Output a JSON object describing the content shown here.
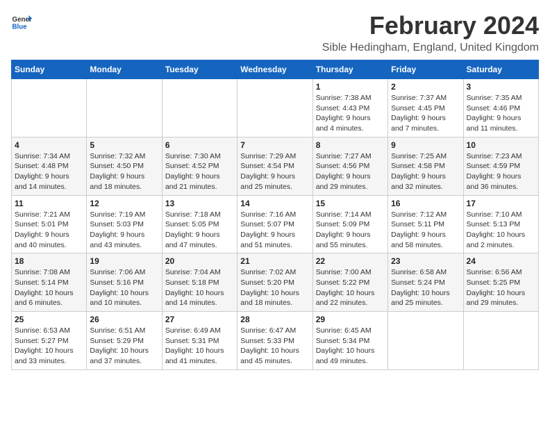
{
  "logo": {
    "line1": "General",
    "line2": "Blue"
  },
  "title": "February 2024",
  "subtitle": "Sible Hedingham, England, United Kingdom",
  "days_of_week": [
    "Sunday",
    "Monday",
    "Tuesday",
    "Wednesday",
    "Thursday",
    "Friday",
    "Saturday"
  ],
  "weeks": [
    [
      {
        "day": "",
        "info": ""
      },
      {
        "day": "",
        "info": ""
      },
      {
        "day": "",
        "info": ""
      },
      {
        "day": "",
        "info": ""
      },
      {
        "day": "1",
        "info": "Sunrise: 7:38 AM\nSunset: 4:43 PM\nDaylight: 9 hours\nand 4 minutes."
      },
      {
        "day": "2",
        "info": "Sunrise: 7:37 AM\nSunset: 4:45 PM\nDaylight: 9 hours\nand 7 minutes."
      },
      {
        "day": "3",
        "info": "Sunrise: 7:35 AM\nSunset: 4:46 PM\nDaylight: 9 hours\nand 11 minutes."
      }
    ],
    [
      {
        "day": "4",
        "info": "Sunrise: 7:34 AM\nSunset: 4:48 PM\nDaylight: 9 hours\nand 14 minutes."
      },
      {
        "day": "5",
        "info": "Sunrise: 7:32 AM\nSunset: 4:50 PM\nDaylight: 9 hours\nand 18 minutes."
      },
      {
        "day": "6",
        "info": "Sunrise: 7:30 AM\nSunset: 4:52 PM\nDaylight: 9 hours\nand 21 minutes."
      },
      {
        "day": "7",
        "info": "Sunrise: 7:29 AM\nSunset: 4:54 PM\nDaylight: 9 hours\nand 25 minutes."
      },
      {
        "day": "8",
        "info": "Sunrise: 7:27 AM\nSunset: 4:56 PM\nDaylight: 9 hours\nand 29 minutes."
      },
      {
        "day": "9",
        "info": "Sunrise: 7:25 AM\nSunset: 4:58 PM\nDaylight: 9 hours\nand 32 minutes."
      },
      {
        "day": "10",
        "info": "Sunrise: 7:23 AM\nSunset: 4:59 PM\nDaylight: 9 hours\nand 36 minutes."
      }
    ],
    [
      {
        "day": "11",
        "info": "Sunrise: 7:21 AM\nSunset: 5:01 PM\nDaylight: 9 hours\nand 40 minutes."
      },
      {
        "day": "12",
        "info": "Sunrise: 7:19 AM\nSunset: 5:03 PM\nDaylight: 9 hours\nand 43 minutes."
      },
      {
        "day": "13",
        "info": "Sunrise: 7:18 AM\nSunset: 5:05 PM\nDaylight: 9 hours\nand 47 minutes."
      },
      {
        "day": "14",
        "info": "Sunrise: 7:16 AM\nSunset: 5:07 PM\nDaylight: 9 hours\nand 51 minutes."
      },
      {
        "day": "15",
        "info": "Sunrise: 7:14 AM\nSunset: 5:09 PM\nDaylight: 9 hours\nand 55 minutes."
      },
      {
        "day": "16",
        "info": "Sunrise: 7:12 AM\nSunset: 5:11 PM\nDaylight: 9 hours\nand 58 minutes."
      },
      {
        "day": "17",
        "info": "Sunrise: 7:10 AM\nSunset: 5:13 PM\nDaylight: 10 hours\nand 2 minutes."
      }
    ],
    [
      {
        "day": "18",
        "info": "Sunrise: 7:08 AM\nSunset: 5:14 PM\nDaylight: 10 hours\nand 6 minutes."
      },
      {
        "day": "19",
        "info": "Sunrise: 7:06 AM\nSunset: 5:16 PM\nDaylight: 10 hours\nand 10 minutes."
      },
      {
        "day": "20",
        "info": "Sunrise: 7:04 AM\nSunset: 5:18 PM\nDaylight: 10 hours\nand 14 minutes."
      },
      {
        "day": "21",
        "info": "Sunrise: 7:02 AM\nSunset: 5:20 PM\nDaylight: 10 hours\nand 18 minutes."
      },
      {
        "day": "22",
        "info": "Sunrise: 7:00 AM\nSunset: 5:22 PM\nDaylight: 10 hours\nand 22 minutes."
      },
      {
        "day": "23",
        "info": "Sunrise: 6:58 AM\nSunset: 5:24 PM\nDaylight: 10 hours\nand 25 minutes."
      },
      {
        "day": "24",
        "info": "Sunrise: 6:56 AM\nSunset: 5:25 PM\nDaylight: 10 hours\nand 29 minutes."
      }
    ],
    [
      {
        "day": "25",
        "info": "Sunrise: 6:53 AM\nSunset: 5:27 PM\nDaylight: 10 hours\nand 33 minutes."
      },
      {
        "day": "26",
        "info": "Sunrise: 6:51 AM\nSunset: 5:29 PM\nDaylight: 10 hours\nand 37 minutes."
      },
      {
        "day": "27",
        "info": "Sunrise: 6:49 AM\nSunset: 5:31 PM\nDaylight: 10 hours\nand 41 minutes."
      },
      {
        "day": "28",
        "info": "Sunrise: 6:47 AM\nSunset: 5:33 PM\nDaylight: 10 hours\nand 45 minutes."
      },
      {
        "day": "29",
        "info": "Sunrise: 6:45 AM\nSunset: 5:34 PM\nDaylight: 10 hours\nand 49 minutes."
      },
      {
        "day": "",
        "info": ""
      },
      {
        "day": "",
        "info": ""
      }
    ]
  ]
}
